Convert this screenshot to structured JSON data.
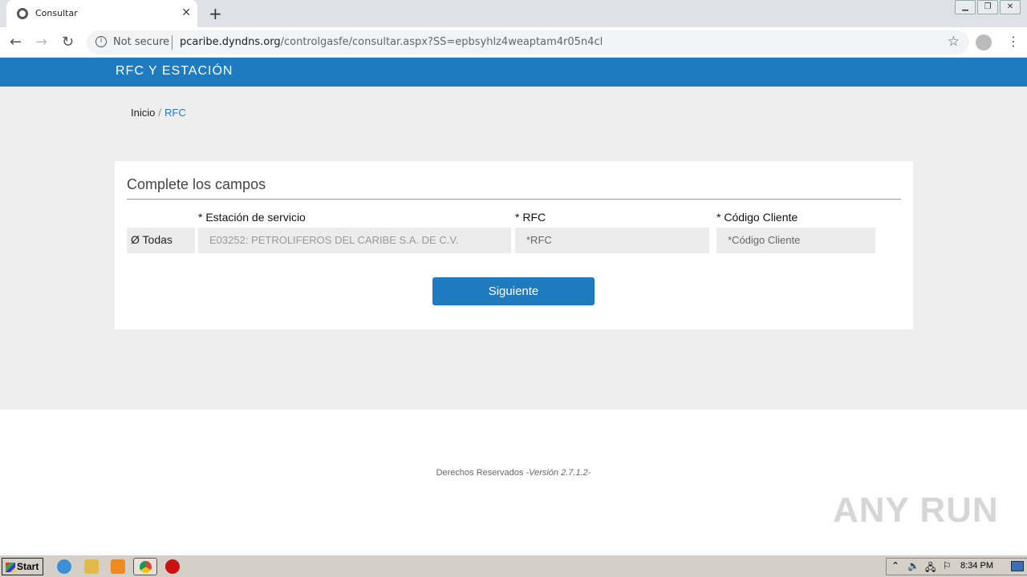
{
  "browser": {
    "tab_title": "Consultar",
    "security_label": "Not secure",
    "url_host": "pcaribe.dyndns.org",
    "url_path": "/controlgasfe/consultar.aspx?SS=epbsyhlz4weaptam4r05n4cl"
  },
  "header": {
    "brand": "RFC Y ESTACIÓN"
  },
  "breadcrumb": {
    "home": "Inicio",
    "separator": "/",
    "current": "RFC"
  },
  "form": {
    "title": "Complete los campos",
    "todas_label": "Ø Todas",
    "station_label": "* Estación de servicio",
    "station_value": "E03252: PETROLIFEROS DEL CARIBE S.A. DE C.V.",
    "rfc_label": "* RFC",
    "rfc_placeholder": "*RFC",
    "client_label": "* Código Cliente",
    "client_placeholder": "*Código Cliente",
    "submit_label": "Siguiente"
  },
  "footer": {
    "rights": "Derechos Reservados",
    "version": "-Versión 2.7.1.2-"
  },
  "watermark": "ANY RUN",
  "taskbar": {
    "start_label": "Start",
    "clock": "8:34 PM"
  },
  "colors": {
    "accent": "#1f7bbf",
    "page_bg": "#eeeeee"
  }
}
